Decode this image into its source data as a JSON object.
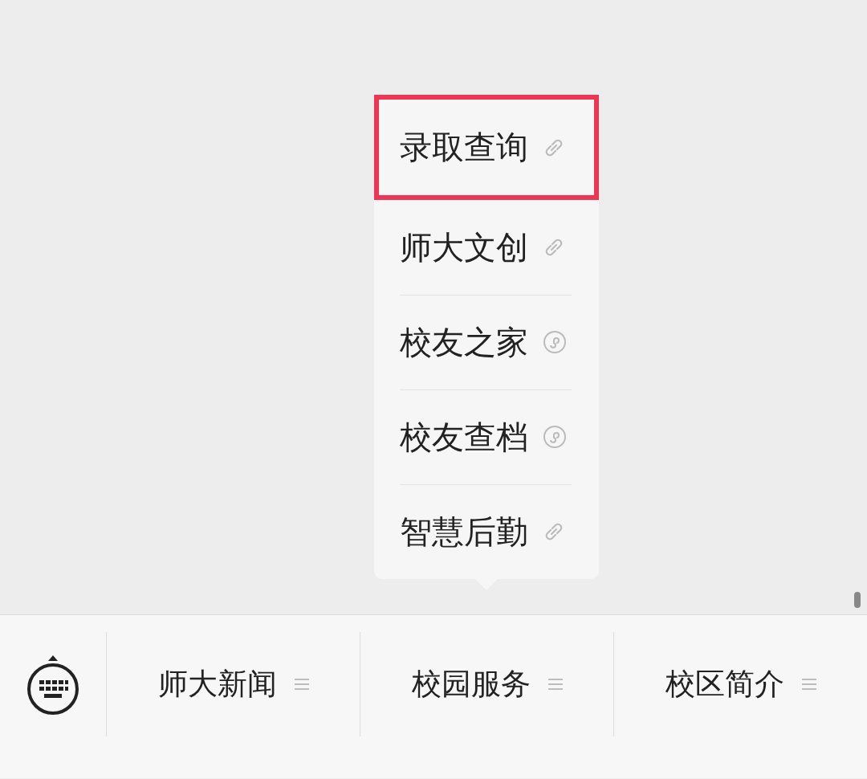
{
  "popup_menu": {
    "items": [
      {
        "label": "录取查询",
        "kind": "link",
        "selected": true
      },
      {
        "label": "师大文创",
        "kind": "link",
        "selected": false
      },
      {
        "label": "校友之家",
        "kind": "miniprogram",
        "selected": false
      },
      {
        "label": "校友查档",
        "kind": "miniprogram",
        "selected": false
      },
      {
        "label": "智慧后勤",
        "kind": "link",
        "selected": false
      }
    ]
  },
  "bottom_menu": {
    "items": [
      {
        "label": "师大新闻"
      },
      {
        "label": "校园服务"
      },
      {
        "label": "校区简介"
      }
    ]
  }
}
